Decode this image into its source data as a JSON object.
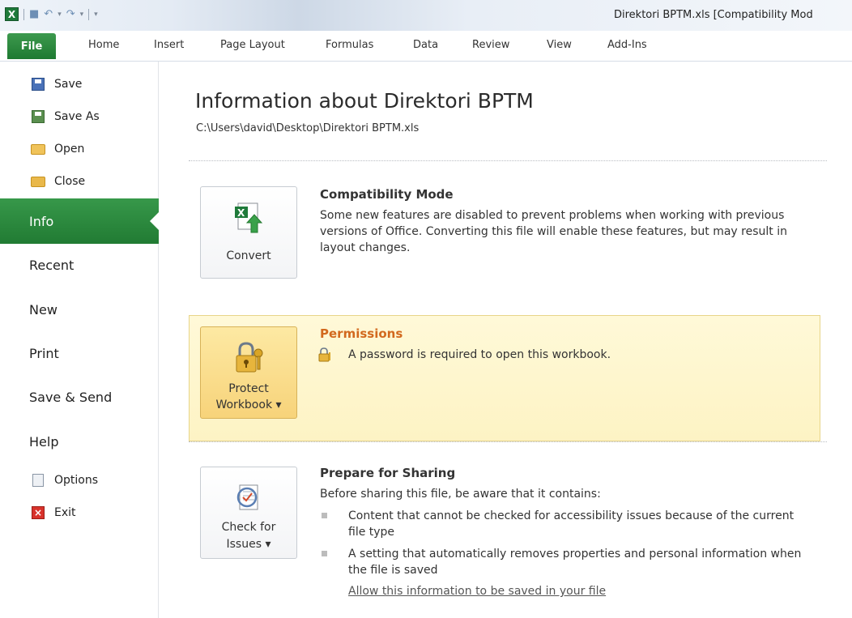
{
  "window": {
    "title": "Direktori BPTM.xls  [Compatibility Mod",
    "app_icon_letter": "X"
  },
  "ribbon": {
    "tabs": [
      "File",
      "Home",
      "Insert",
      "Page Layout",
      "Formulas",
      "Data",
      "Review",
      "View",
      "Add-Ins"
    ]
  },
  "nav": {
    "save": "Save",
    "save_as": "Save As",
    "open": "Open",
    "close": "Close",
    "info": "Info",
    "recent": "Recent",
    "new": "New",
    "print": "Print",
    "save_send": "Save & Send",
    "help": "Help",
    "options": "Options",
    "exit": "Exit"
  },
  "info": {
    "title": "Information about Direktori BPTM",
    "path": "C:\\Users\\david\\Desktop\\Direktori BPTM.xls",
    "compat": {
      "button_label": "Convert",
      "heading": "Compatibility Mode",
      "text": "Some new features are disabled to prevent problems when working with previous versions of Office. Converting this file will enable these features, but may result in layout changes."
    },
    "permissions": {
      "button_line1": "Protect",
      "button_line2": "Workbook ▾",
      "heading": "Permissions",
      "text": "A password is required to open this workbook."
    },
    "sharing": {
      "button_line1": "Check for",
      "button_line2": "Issues ▾",
      "heading": "Prepare for Sharing",
      "intro": "Before sharing this file, be aware that it contains:",
      "bullets": [
        "Content that cannot be checked for accessibility issues because of the current file type",
        "A setting that automatically removes properties and personal information when the file is saved"
      ],
      "link": "Allow this information to be saved in your file"
    }
  },
  "colors": {
    "file_green": "#1e7a31",
    "permissions_heading": "#d2691e",
    "permission_band": "#fdf3c4"
  }
}
